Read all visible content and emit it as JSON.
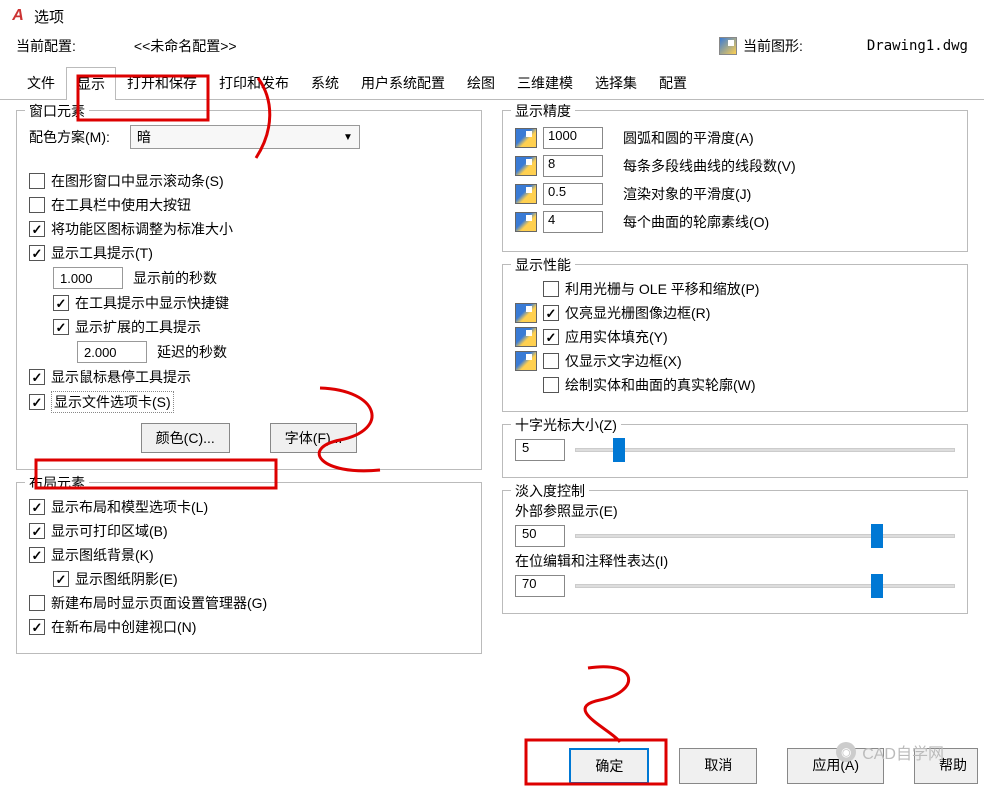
{
  "title": "选项",
  "current_config_label": "当前配置:",
  "current_config_value": "<<未命名配置>>",
  "current_drawing_label": "当前图形:",
  "current_drawing_value": "Drawing1.dwg",
  "tabs": [
    "文件",
    "显示",
    "打开和保存",
    "打印和发布",
    "系统",
    "用户系统配置",
    "绘图",
    "三维建模",
    "选择集",
    "配置"
  ],
  "active_tab_index": 1,
  "window_elements": {
    "title": "窗口元素",
    "color_scheme_label": "配色方案(M):",
    "color_scheme_value": "暗",
    "show_scrollbars": "在图形窗口中显示滚动条(S)",
    "big_buttons": "在工具栏中使用大按钮",
    "resize_icons": "将功能区图标调整为标准大小",
    "show_tooltips": "显示工具提示(T)",
    "seconds_before": "1.000",
    "seconds_before_label": "显示前的秒数",
    "show_shortcuts": "在工具提示中显示快捷键",
    "show_extended": "显示扩展的工具提示",
    "delay_seconds": "2.000",
    "delay_seconds_label": "延迟的秒数",
    "show_hover": "显示鼠标悬停工具提示",
    "show_file_tabs": "显示文件选项卡(S)",
    "colors_btn": "颜色(C)...",
    "fonts_btn": "字体(F)..."
  },
  "layout_elements": {
    "title": "布局元素",
    "show_layout_tabs": "显示布局和模型选项卡(L)",
    "show_printable": "显示可打印区域(B)",
    "show_paper_bg": "显示图纸背景(K)",
    "show_paper_shadow": "显示图纸阴影(E)",
    "new_layout_pagesetup": "新建布局时显示页面设置管理器(G)",
    "create_viewport": "在新布局中创建视口(N)"
  },
  "display_precision": {
    "title": "显示精度",
    "arc_value": "1000",
    "arc_label": "圆弧和圆的平滑度(A)",
    "polyline_value": "8",
    "polyline_label": "每条多段线曲线的线段数(V)",
    "render_value": "0.5",
    "render_label": "渲染对象的平滑度(J)",
    "surface_value": "4",
    "surface_label": "每个曲面的轮廓素线(O)"
  },
  "display_perf": {
    "title": "显示性能",
    "raster_pan": "利用光栅与 OLE 平移和缩放(P)",
    "raster_frame": "仅亮显光栅图像边框(R)",
    "solid_fill": "应用实体填充(Y)",
    "text_frame": "仅显示文字边框(X)",
    "true_sil": "绘制实体和曲面的真实轮廓(W)"
  },
  "crosshair": {
    "title": "十字光标大小(Z)",
    "value": "5"
  },
  "fade": {
    "title": "淡入度控制",
    "xref_label": "外部参照显示(E)",
    "xref_value": "50",
    "inplace_label": "在位编辑和注释性表达(I)",
    "inplace_value": "70"
  },
  "buttons": {
    "ok": "确定",
    "cancel": "取消",
    "apply": "应用(A)",
    "help": "帮助"
  },
  "watermark": "CAD自学网"
}
